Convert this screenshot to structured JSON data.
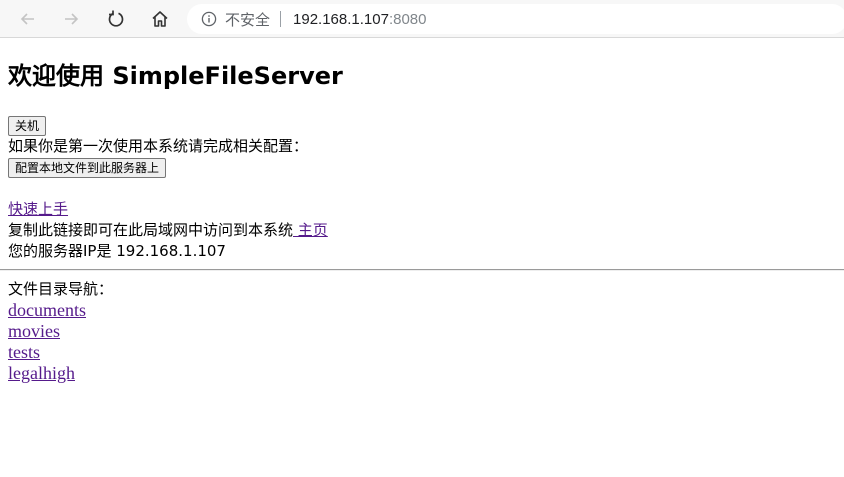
{
  "browser": {
    "security_label": "不安全",
    "address_host": "192.168.1.107",
    "address_port": ":8080"
  },
  "page": {
    "title": "欢迎使用 SimpleFileServer",
    "shutdown_button": "关机",
    "first_time_text": "如果你是第一次使用本系统请完成相关配置：",
    "config_button": "配置本地文件到此服务器上",
    "quick_start_link": "快速上手",
    "copy_link_text": "复制此链接即可在此局域网中访问到本系统",
    "home_link": " 主页",
    "server_ip_text": "您的服务器IP是 192.168.1.107",
    "directory_nav_label": "文件目录导航：",
    "directories": [
      "documents",
      "movies",
      "tests",
      "legalhigh"
    ]
  }
}
